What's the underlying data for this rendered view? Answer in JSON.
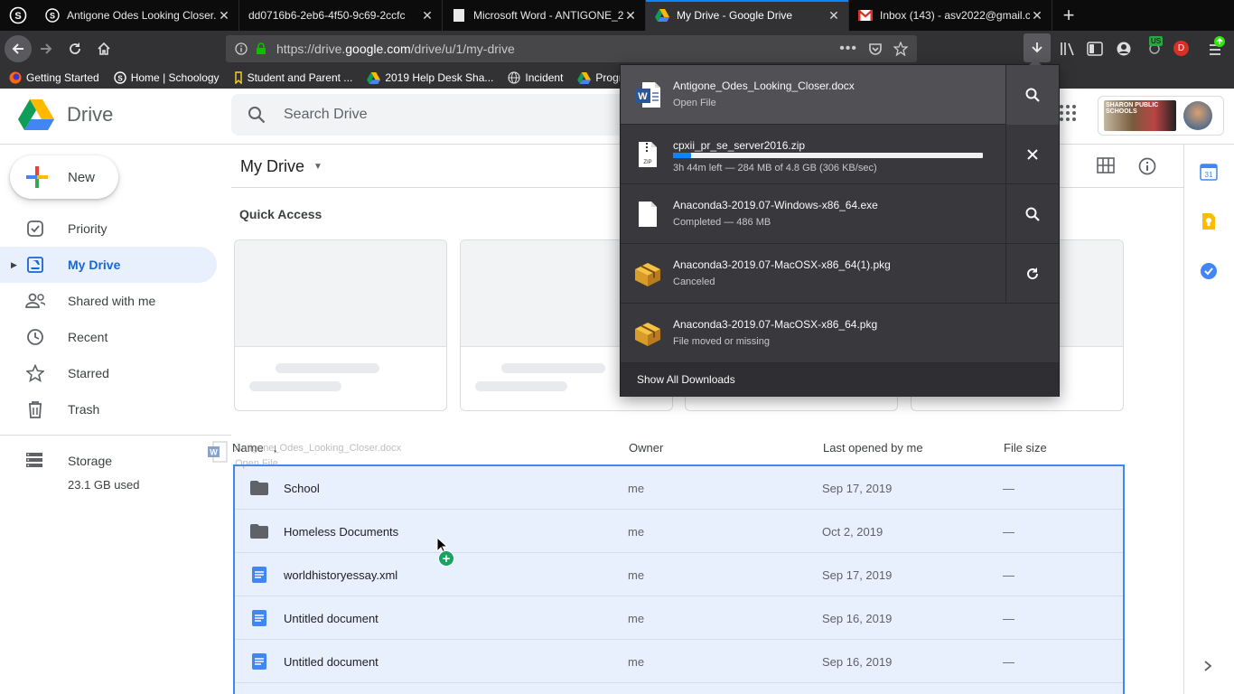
{
  "browser": {
    "tabs": [
      {
        "title": "Antigone Odes Looking Closer.d",
        "favicon": "schoology-icon"
      },
      {
        "title": "dd0716b6-2eb6-4f50-9c69-2ccfc",
        "favicon": "blank-page-icon"
      },
      {
        "title": "Microsoft Word - ANTIGONE_2",
        "favicon": "blank-page-icon"
      },
      {
        "title": "My Drive - Google Drive",
        "favicon": "google-drive-icon",
        "active": true
      },
      {
        "title": "Inbox (143) - asv2022@gmail.c",
        "favicon": "gmail-icon"
      }
    ],
    "url_prefix": "https://drive.",
    "url_domain": "google.com",
    "url_path": "/drive/u/1/my-drive",
    "bookmarks": [
      {
        "label": "Getting Started",
        "icon": "firefox-icon"
      },
      {
        "label": "Home | Schoology",
        "icon": "schoology-icon"
      },
      {
        "label": "Student and Parent ...",
        "icon": "bookmark-icon"
      },
      {
        "label": "2019 Help Desk Sha...",
        "icon": "google-drive-icon"
      },
      {
        "label": "Incident",
        "icon": "globe-icon"
      },
      {
        "label": "Programi",
        "icon": "google-drive-icon"
      }
    ],
    "badge_us": "US",
    "badge_d": "D",
    "accent": "#0a84ff"
  },
  "drive": {
    "logo_text": "Drive",
    "search_placeholder": "Search Drive",
    "new_label": "New",
    "nav": [
      {
        "label": "Priority",
        "icon": "priority-icon"
      },
      {
        "label": "My Drive",
        "icon": "my-drive-icon",
        "selected": true
      },
      {
        "label": "Shared with me",
        "icon": "shared-icon"
      },
      {
        "label": "Recent",
        "icon": "clock-icon"
      },
      {
        "label": "Starred",
        "icon": "star-icon"
      },
      {
        "label": "Trash",
        "icon": "trash-icon"
      }
    ],
    "storage_label": "Storage",
    "storage_used": "23.1 GB used",
    "school_logo_text": "SHARON PUBLIC SCHOOLS",
    "title": "My Drive",
    "quick_access": "Quick Access",
    "columns": {
      "name": "Name",
      "owner": "Owner",
      "last_opened": "Last opened by me",
      "size": "File size"
    },
    "files": [
      {
        "name": "School",
        "type": "folder",
        "owner": "me",
        "date": "Sep 17, 2019",
        "size": "—"
      },
      {
        "name": "Homeless Documents",
        "type": "folder",
        "owner": "me",
        "date": "Oct 2, 2019",
        "size": "—"
      },
      {
        "name": "worldhistoryessay.xml",
        "type": "doc",
        "owner": "me",
        "date": "Sep 17, 2019",
        "size": "—"
      },
      {
        "name": "Untitled document",
        "type": "doc",
        "owner": "me",
        "date": "Sep 16, 2019",
        "size": "—"
      },
      {
        "name": "Untitled document",
        "type": "doc",
        "owner": "me",
        "date": "Sep 16, 2019",
        "size": "—"
      }
    ],
    "drag_ghost_name": "Antigone_Odes_Looking_Closer.docx",
    "drag_ghost_sub": "Open File",
    "selection_color": "#e8f0fe"
  },
  "downloads": {
    "items": [
      {
        "name": "Antigone_Odes_Looking_Closer.docx",
        "status": "Open File",
        "icon": "word-doc-icon",
        "action": "search-icon",
        "highlighted": true
      },
      {
        "name": "cpxii_pr_se_server2016.zip",
        "status": "3h 44m left — 284 MB of 4.8 GB (306 KB/sec)",
        "icon": "zip-file-icon",
        "action": "close-icon",
        "progress": 0.058
      },
      {
        "name": "Anaconda3-2019.07-Windows-x86_64.exe",
        "status": "Completed — 486 MB",
        "icon": "blank-file-icon",
        "action": "search-icon"
      },
      {
        "name": "Anaconda3-2019.07-MacOSX-x86_64(1).pkg",
        "status": "Canceled",
        "icon": "package-icon",
        "action": "retry-icon"
      },
      {
        "name": "Anaconda3-2019.07-MacOSX-x86_64.pkg",
        "status": "File moved or missing",
        "icon": "package-icon",
        "action": ""
      }
    ],
    "show_all": "Show All Downloads"
  }
}
